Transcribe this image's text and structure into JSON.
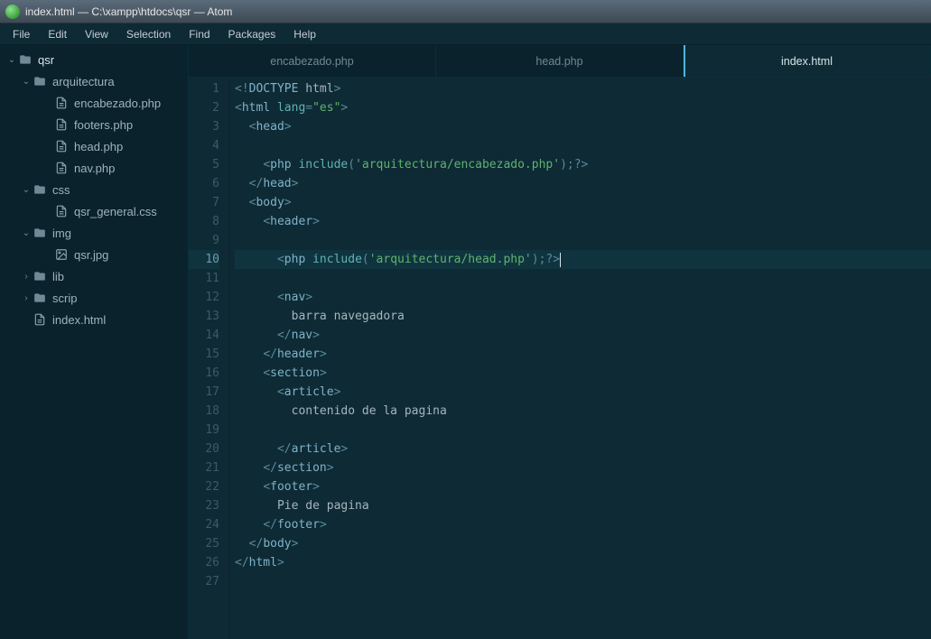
{
  "title": "index.html — C:\\xampp\\htdocs\\qsr — Atom",
  "menu": [
    "File",
    "Edit",
    "View",
    "Selection",
    "Find",
    "Packages",
    "Help"
  ],
  "tree": {
    "root": "qsr",
    "items": [
      {
        "type": "folder",
        "name": "arquitectura",
        "open": true,
        "children": [
          {
            "type": "file",
            "name": "encabezado.php"
          },
          {
            "type": "file",
            "name": "footers.php"
          },
          {
            "type": "file",
            "name": "head.php"
          },
          {
            "type": "file",
            "name": "nav.php"
          }
        ]
      },
      {
        "type": "folder",
        "name": "css",
        "open": true,
        "children": [
          {
            "type": "file",
            "name": "qsr_general.css"
          }
        ]
      },
      {
        "type": "folder",
        "name": "img",
        "open": true,
        "children": [
          {
            "type": "image",
            "name": "qsr.jpg"
          }
        ]
      },
      {
        "type": "folder",
        "name": "lib",
        "open": false
      },
      {
        "type": "folder",
        "name": "scrip",
        "open": false
      },
      {
        "type": "file",
        "name": "index.html"
      }
    ]
  },
  "tabs": [
    {
      "label": "encabezado.php",
      "active": false
    },
    {
      "label": "head.php",
      "active": false
    },
    {
      "label": "index.html",
      "active": true
    }
  ],
  "editor": {
    "current_line": 10,
    "lines": [
      [
        {
          "t": "<!",
          "c": "punc"
        },
        {
          "t": "DOCTYPE",
          "c": "doct"
        },
        {
          "t": " html",
          "c": "txt"
        },
        {
          "t": ">",
          "c": "punc"
        }
      ],
      [
        {
          "t": "<",
          "c": "punc"
        },
        {
          "t": "html",
          "c": "kw"
        },
        {
          "t": " ",
          "c": "txt"
        },
        {
          "t": "lang",
          "c": "attr"
        },
        {
          "t": "=",
          "c": "punc"
        },
        {
          "t": "\"es\"",
          "c": "str"
        },
        {
          "t": ">",
          "c": "punc"
        }
      ],
      [
        {
          "t": "  ",
          "c": "txt"
        },
        {
          "t": "<",
          "c": "punc"
        },
        {
          "t": "head",
          "c": "kw"
        },
        {
          "t": ">",
          "c": "punc"
        }
      ],
      [],
      [
        {
          "t": "    ",
          "c": "txt"
        },
        {
          "t": "<",
          "c": "punc"
        },
        {
          "t": "php",
          "c": "kw"
        },
        {
          "t": " ",
          "c": "txt"
        },
        {
          "t": "include",
          "c": "attr"
        },
        {
          "t": "(",
          "c": "punc"
        },
        {
          "t": "'arquitectura/encabezado.php'",
          "c": "str"
        },
        {
          "t": ");?",
          "c": "punc"
        },
        {
          "t": ">",
          "c": "punc"
        }
      ],
      [
        {
          "t": "  ",
          "c": "txt"
        },
        {
          "t": "</",
          "c": "punc"
        },
        {
          "t": "head",
          "c": "kw"
        },
        {
          "t": ">",
          "c": "punc"
        }
      ],
      [
        {
          "t": "  ",
          "c": "txt"
        },
        {
          "t": "<",
          "c": "punc"
        },
        {
          "t": "body",
          "c": "kw"
        },
        {
          "t": ">",
          "c": "punc"
        }
      ],
      [
        {
          "t": "    ",
          "c": "txt"
        },
        {
          "t": "<",
          "c": "punc"
        },
        {
          "t": "header",
          "c": "kw"
        },
        {
          "t": ">",
          "c": "punc"
        }
      ],
      [],
      [
        {
          "t": "      ",
          "c": "txt"
        },
        {
          "t": "<",
          "c": "punc"
        },
        {
          "t": "php",
          "c": "kw"
        },
        {
          "t": " ",
          "c": "txt"
        },
        {
          "t": "include",
          "c": "attr"
        },
        {
          "t": "(",
          "c": "punc"
        },
        {
          "t": "'arquitectura/head.php'",
          "c": "str"
        },
        {
          "t": ");?",
          "c": "punc"
        },
        {
          "t": ">",
          "c": "punc"
        }
      ],
      [],
      [
        {
          "t": "      ",
          "c": "txt"
        },
        {
          "t": "<",
          "c": "punc"
        },
        {
          "t": "nav",
          "c": "kw"
        },
        {
          "t": ">",
          "c": "punc"
        }
      ],
      [
        {
          "t": "        barra navegadora",
          "c": "txt"
        }
      ],
      [
        {
          "t": "      ",
          "c": "txt"
        },
        {
          "t": "</",
          "c": "punc"
        },
        {
          "t": "nav",
          "c": "kw"
        },
        {
          "t": ">",
          "c": "punc"
        }
      ],
      [
        {
          "t": "    ",
          "c": "txt"
        },
        {
          "t": "</",
          "c": "punc"
        },
        {
          "t": "header",
          "c": "kw"
        },
        {
          "t": ">",
          "c": "punc"
        }
      ],
      [
        {
          "t": "    ",
          "c": "txt"
        },
        {
          "t": "<",
          "c": "punc"
        },
        {
          "t": "section",
          "c": "kw"
        },
        {
          "t": ">",
          "c": "punc"
        }
      ],
      [
        {
          "t": "      ",
          "c": "txt"
        },
        {
          "t": "<",
          "c": "punc"
        },
        {
          "t": "article",
          "c": "kw"
        },
        {
          "t": ">",
          "c": "punc"
        }
      ],
      [
        {
          "t": "        contenido de la pagina",
          "c": "txt"
        }
      ],
      [],
      [
        {
          "t": "      ",
          "c": "txt"
        },
        {
          "t": "</",
          "c": "punc"
        },
        {
          "t": "article",
          "c": "kw"
        },
        {
          "t": ">",
          "c": "punc"
        }
      ],
      [
        {
          "t": "    ",
          "c": "txt"
        },
        {
          "t": "</",
          "c": "punc"
        },
        {
          "t": "section",
          "c": "kw"
        },
        {
          "t": ">",
          "c": "punc"
        }
      ],
      [
        {
          "t": "    ",
          "c": "txt"
        },
        {
          "t": "<",
          "c": "punc"
        },
        {
          "t": "footer",
          "c": "kw"
        },
        {
          "t": ">",
          "c": "punc"
        }
      ],
      [
        {
          "t": "      Pie de pagina",
          "c": "txt"
        }
      ],
      [
        {
          "t": "    ",
          "c": "txt"
        },
        {
          "t": "</",
          "c": "punc"
        },
        {
          "t": "footer",
          "c": "kw"
        },
        {
          "t": ">",
          "c": "punc"
        }
      ],
      [
        {
          "t": "  ",
          "c": "txt"
        },
        {
          "t": "</",
          "c": "punc"
        },
        {
          "t": "body",
          "c": "kw"
        },
        {
          "t": ">",
          "c": "punc"
        }
      ],
      [
        {
          "t": "</",
          "c": "punc"
        },
        {
          "t": "html",
          "c": "kw"
        },
        {
          "t": ">",
          "c": "punc"
        }
      ],
      []
    ]
  }
}
